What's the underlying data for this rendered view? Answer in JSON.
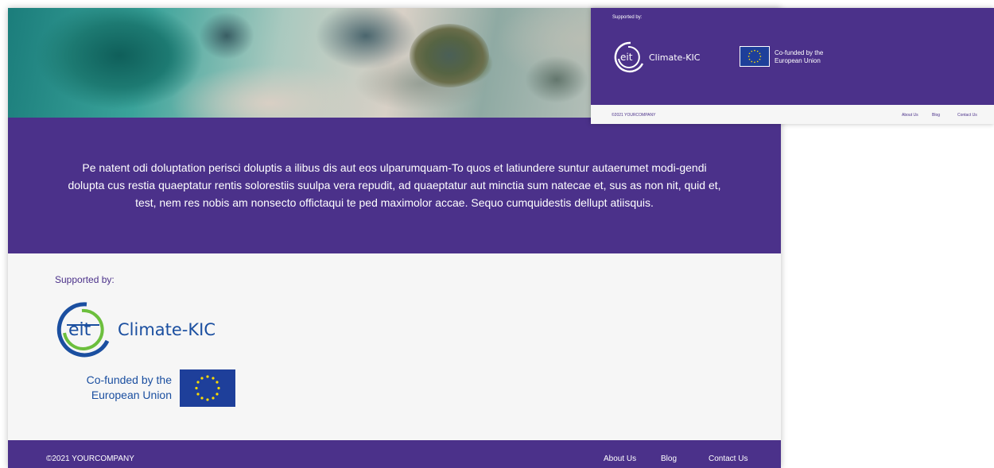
{
  "main": {
    "body_text": "Pe natent odi doluptation perisci doluptis a ilibus dis aut eos ulparumquam-To quos et latiundere suntur autaerumet modi-gendi dolupta cus restia quaeptatur rentis solorestiis suulpa vera repudit, ad quaeptatur aut minctia sum natecae et, sus as non nit, quid et, test, nem res nobis am nonsecto offictaqui te ped maximolor accae. Sequo cumquidestis dellupt atiisquis.",
    "supported_by": "Supported by:",
    "eit_wordmark": "eit",
    "climate_kic": "Climate-KIC",
    "eu_cofunded_line1": "Co-funded by the",
    "eu_cofunded_line2": "European Union",
    "footer": {
      "copyright": "©2021 YOURCOMPANY",
      "links": [
        "About Us",
        "Blog",
        "Contact Us"
      ]
    }
  },
  "preview": {
    "supported_by": "Supported by:",
    "eit_wordmark": "eit",
    "climate_kic": "Climate-KIC",
    "eu_cofunded_line1": "Co-funded by the",
    "eu_cofunded_line2": "European Union",
    "footer": {
      "copyright": "©2021 YOURCOMPANY",
      "links": [
        "About Us",
        "Blog",
        "Contact Us"
      ]
    }
  },
  "colors": {
    "brand_purple": "#4b318a",
    "eit_blue": "#1b4fa0",
    "eit_green": "#6cbf3d",
    "eu_blue": "#1e3f9a",
    "eu_star": "#ffdd00"
  }
}
